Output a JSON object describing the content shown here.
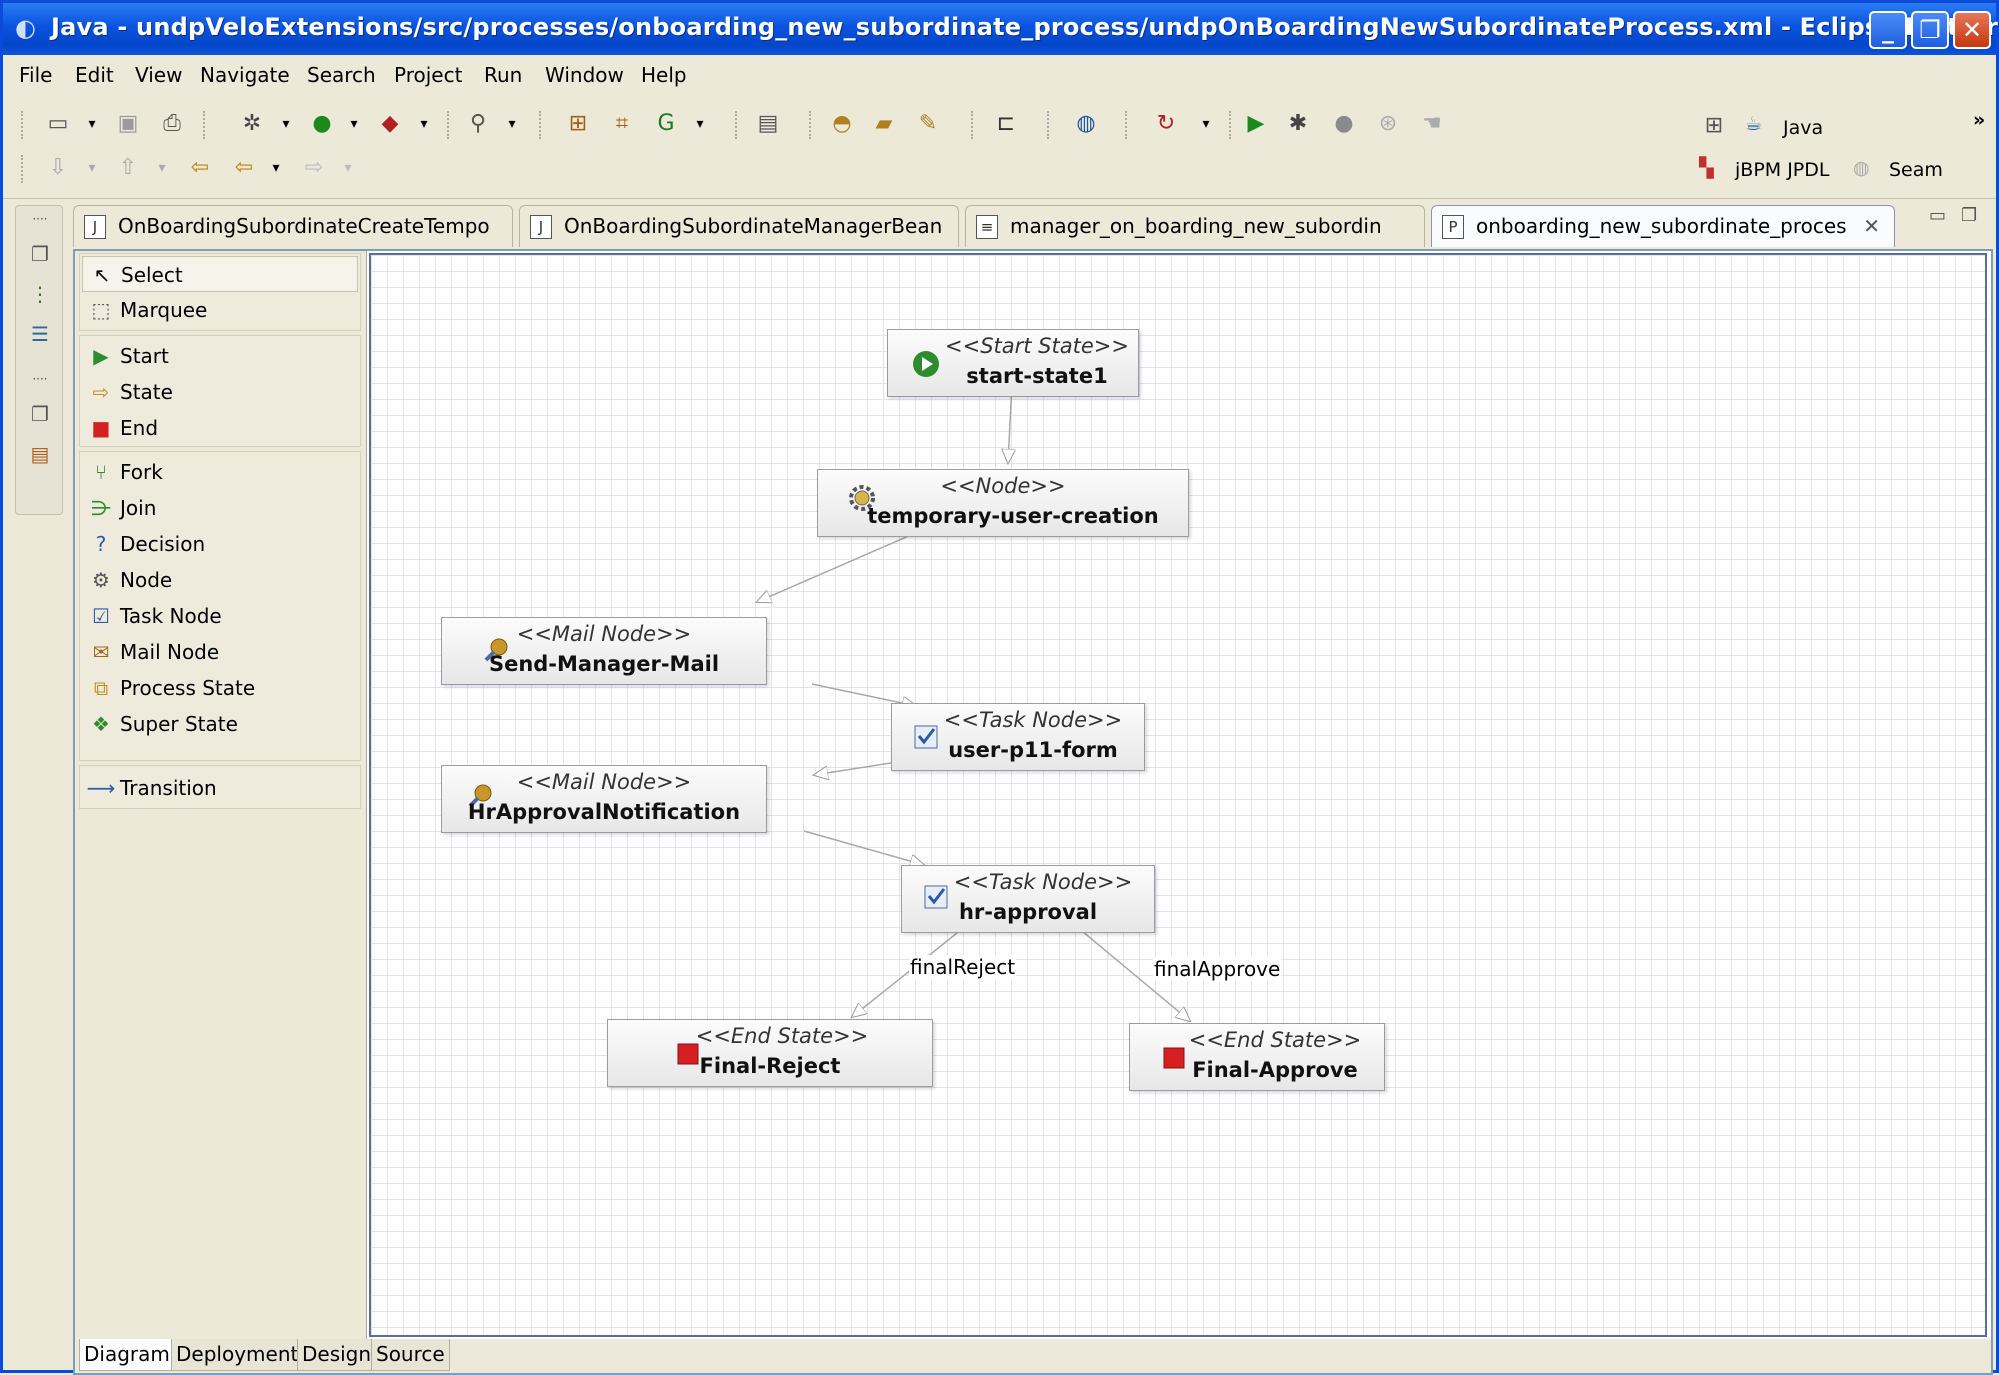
{
  "window": {
    "title": "Java - undpVeloExtensions/src/processes/onboarding_new_subordinate_process/undpOnBoardingNewSubordinateProcess.xml - Eclipse Platform",
    "min_glyph": "_",
    "max_glyph": "❐",
    "close_glyph": "✕"
  },
  "menu": [
    "File",
    "Edit",
    "View",
    "Navigate",
    "Search",
    "Project",
    "Run",
    "Window",
    "Help"
  ],
  "perspectives": {
    "java": "Java",
    "jbpm": "jBPM JPDL",
    "seam": "Seam",
    "more": "»"
  },
  "editor_tabs": [
    {
      "label": "OnBoardingSubordinateCreateTempo",
      "icon": "J"
    },
    {
      "label": "OnBoardingSubordinateManagerBean",
      "icon": "J"
    },
    {
      "label": "manager_on_boarding_new_subordin",
      "icon": "≡"
    },
    {
      "label": "onboarding_new_subordinate_proces",
      "icon": "P",
      "close": "✕"
    }
  ],
  "palette": {
    "select": "Select",
    "marquee": "Marquee",
    "start": "Start",
    "state": "State",
    "end": "End",
    "fork": "Fork",
    "join": "Join",
    "decision": "Decision",
    "node": "Node",
    "task_node": "Task Node",
    "mail_node": "Mail Node",
    "process_state": "Process State",
    "super_state": "Super State",
    "transition": "Transition"
  },
  "nodes": {
    "start": {
      "stereotype": "<<Start State>>",
      "name": "start-state1"
    },
    "tmp": {
      "stereotype": "<<Node>>",
      "name": "temporary-user-creation"
    },
    "mail1": {
      "stereotype": "<<Mail Node>>",
      "name": "Send-Manager-Mail"
    },
    "p11": {
      "stereotype": "<<Task Node>>",
      "name": "user-p11-form"
    },
    "mail2": {
      "stereotype": "<<Mail Node>>",
      "name": "HrApprovalNotification"
    },
    "hr": {
      "stereotype": "<<Task Node>>",
      "name": "hr-approval"
    },
    "reject": {
      "stereotype": "<<End State>>",
      "name": "Final-Reject"
    },
    "approve": {
      "stereotype": "<<End State>>",
      "name": "Final-Approve"
    }
  },
  "transitions": {
    "reject_label": "finalReject",
    "approve_label": "finalApprove"
  },
  "bottom_tabs": [
    "Diagram",
    "Deployment",
    "Design",
    "Source"
  ],
  "colors": {
    "titlebar": "#0a53df",
    "end_state": "#d42020",
    "start_state": "#2e8b2e"
  }
}
